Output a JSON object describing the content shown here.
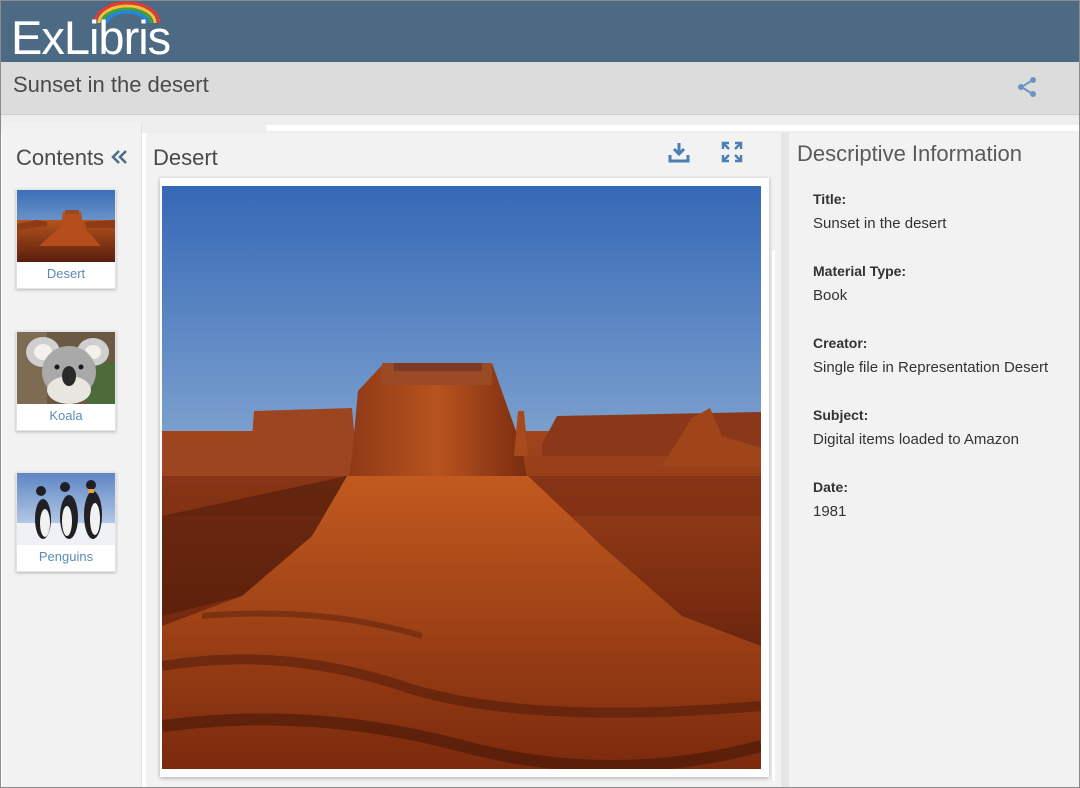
{
  "header": {
    "logo_text": "ExLibris",
    "title": "Sunset in the desert"
  },
  "contents": {
    "title": "Contents",
    "items": [
      {
        "label": "Desert"
      },
      {
        "label": "Koala"
      },
      {
        "label": "Penguins"
      }
    ]
  },
  "viewer": {
    "title": "Desert"
  },
  "info": {
    "title": "Descriptive Information",
    "fields": [
      {
        "label": "Title:",
        "value": "Sunset in the desert"
      },
      {
        "label": "Material Type:",
        "value": "Book"
      },
      {
        "label": "Creator:",
        "value": "Single file in Representation Desert"
      },
      {
        "label": "Subject:",
        "value": "Digital items loaded to Amazon"
      },
      {
        "label": "Date:",
        "value": "1981"
      }
    ]
  },
  "colors": {
    "header_bg": "#4d6a85",
    "accent": "#5b8bb8"
  }
}
